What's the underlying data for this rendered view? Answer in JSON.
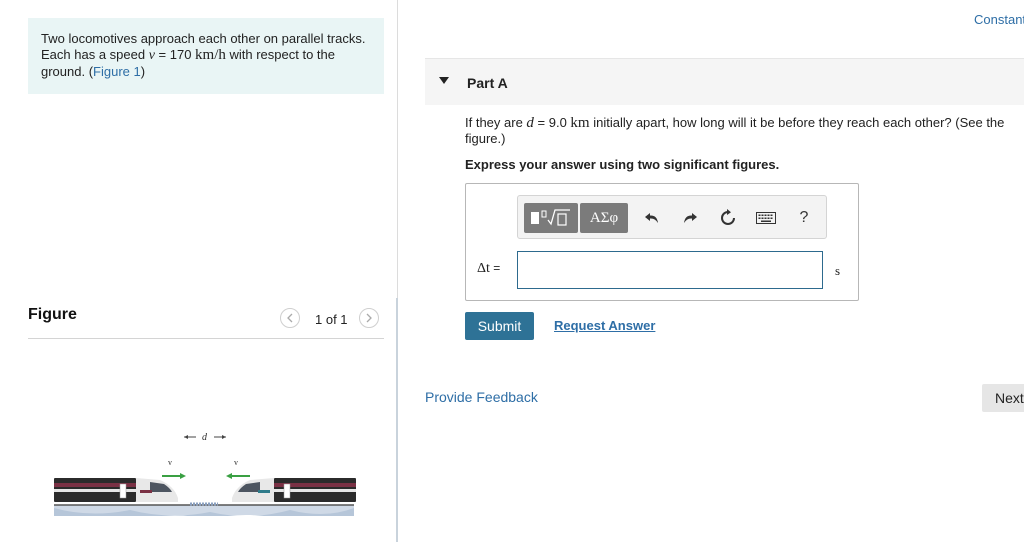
{
  "problem": {
    "text_1": "Two locomotives approach each other on parallel tracks. Each has a speed ",
    "speed_symbol": "v",
    "speed_value": " = 170 ",
    "speed_unit": "km/h",
    "text_2": " with respect to the ground. (",
    "figure_link": "Figure 1",
    "text_3": ")"
  },
  "figure": {
    "title": "Figure",
    "counter": "1 of 1",
    "prev_icon": "chevron-left-icon",
    "next_icon": "chevron-right-icon",
    "d_label": "d",
    "v_label_left": "v",
    "v_label_right": "v"
  },
  "header": {
    "constants_link": "Constant"
  },
  "part": {
    "title": "Part A",
    "question_1": "If they are ",
    "d_symbol": "d",
    "question_2": " = 9.0 ",
    "d_unit": "km",
    "question_3": " initially apart, how long will it be before they reach each other? (See the figure.)",
    "instruction": "Express your answer using two significant figures."
  },
  "toolbar": {
    "templates_icon": "templates-icon",
    "greek_label": "ΑΣφ",
    "undo_icon": "undo-icon",
    "redo_icon": "redo-icon",
    "reset_icon": "reset-icon",
    "keyboard_icon": "keyboard-icon",
    "help_label": "?"
  },
  "answer": {
    "variable": "Δt",
    "equals": " =",
    "value": "",
    "unit": "s"
  },
  "actions": {
    "submit_label": "Submit",
    "request_answer_label": "Request Answer",
    "feedback_label": "Provide Feedback",
    "next_label": "Next"
  },
  "colors": {
    "link": "#2e6ea6",
    "submit_bg": "#2e7296",
    "problem_bg": "#e9f5f5",
    "input_border": "#2d6a8e"
  }
}
